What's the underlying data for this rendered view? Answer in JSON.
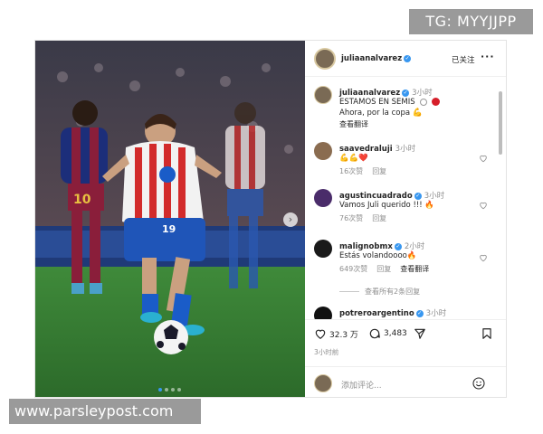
{
  "watermarks": {
    "top_right": "TG: MYYJJPP",
    "bottom_left": "www.parsleypost.com"
  },
  "post": {
    "header": {
      "username": "juliaanalvarez",
      "follow_label": "已关注",
      "more_label": "···"
    },
    "caption": {
      "username": "juliaanalvarez",
      "time": "3小时",
      "line1": "ESTAMOS EN SEMIS",
      "line2": "Ahora, por la copa",
      "translate": "查看翻译"
    },
    "comments": [
      {
        "username": "saavedraluji",
        "time": "3小时",
        "text": "💪💪❤️",
        "likes": "16次赞",
        "reply": "回复"
      },
      {
        "username": "agustincuadrado",
        "time": "3小时",
        "text": "Vamos Juli querido !!! 🔥",
        "likes": "76次赞",
        "reply": "回复"
      },
      {
        "username": "malignobmx",
        "time": "2小时",
        "text": "Estás volandoooo🔥",
        "likes": "649次赞",
        "reply": "回复",
        "translate": "查看翻译"
      },
      {
        "username": "potreroargentino",
        "time": "3小时"
      }
    ],
    "view_replies": "查看所有2条回复",
    "stats": {
      "likes": "32.3 万",
      "comments": "3,483"
    },
    "timestamp": "3小时前",
    "add_comment_placeholder": "添加评论..."
  },
  "colors": {
    "verified": "#3897f0",
    "muted": "#8e8e8e"
  },
  "icons": [
    "heart-icon",
    "comment-icon",
    "share-icon",
    "bookmark-icon",
    "emoji-icon",
    "verified-icon",
    "chevron-right-icon"
  ]
}
